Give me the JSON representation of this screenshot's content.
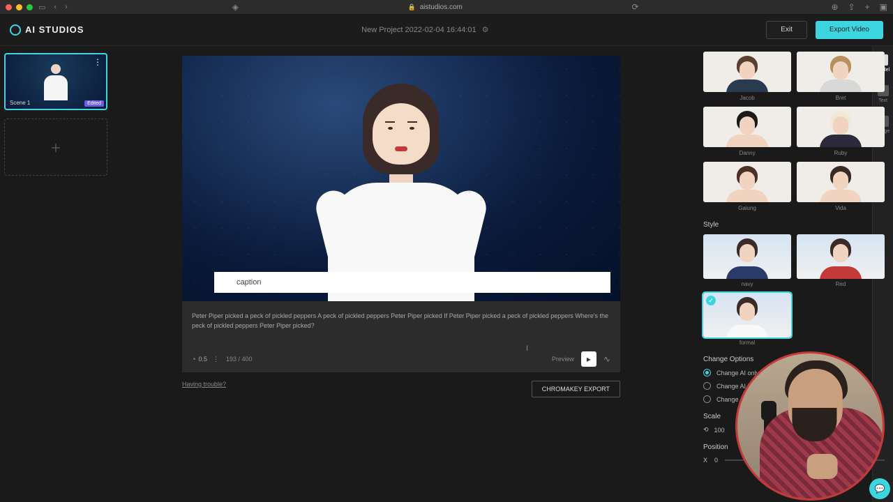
{
  "browser": {
    "url": "aistudios.com"
  },
  "logo": {
    "text": "AI STUDIOS"
  },
  "header": {
    "project_title": "New Project 2022-02-04 16:44:01",
    "exit": "Exit",
    "export": "Export Video"
  },
  "scenes": {
    "items": [
      {
        "label": "Scene 1",
        "badge": "Edited"
      }
    ]
  },
  "canvas": {
    "caption_placeholder": "caption"
  },
  "script": {
    "text": "Peter Piper picked a peck of pickled peppers A peck of pickled peppers Peter Piper picked If Peter Piper picked a peck of pickled peppers Where's the peck of pickled peppers Peter Piper picked?",
    "speed": "0.5",
    "char_count": "193 / 400",
    "preview_label": "Preview"
  },
  "links": {
    "trouble": "Having trouble?",
    "chromakey": "CHROMAKEY EXPORT"
  },
  "rail": {
    "model": "Model",
    "text": "Text",
    "image": "Image"
  },
  "models": [
    {
      "name": "Jacob",
      "hair": "#5a4030",
      "body": "#2a3a50"
    },
    {
      "name": "Bret",
      "hair": "#b89060",
      "body": "#d8d8d8"
    },
    {
      "name": "Danny",
      "hair": "#1a1a1a",
      "body": "#f0d4c0"
    },
    {
      "name": "Ruby",
      "hair": "#f0e8d8",
      "body": "#2a2a3a"
    },
    {
      "name": "Gaiung",
      "hair": "#4a3028",
      "body": "#f0d4c0"
    },
    {
      "name": "Vida",
      "hair": "#3a2a24",
      "body": "#f0d4c0"
    }
  ],
  "style": {
    "title": "Style",
    "items": [
      {
        "name": "navy",
        "body": "#2a3a6a",
        "selected": false
      },
      {
        "name": "Red",
        "body": "#c43a3a",
        "selected": false
      },
      {
        "name": "formal",
        "body": "#f8f8f8",
        "selected": true
      }
    ]
  },
  "change_options": {
    "title": "Change Options",
    "items": [
      {
        "label": "Change AI only in this scene",
        "selected": true
      },
      {
        "label": "Change AI in all scenes",
        "selected": false
      },
      {
        "label": "Change AI from this scene",
        "selected": false
      }
    ]
  },
  "scale": {
    "title": "Scale",
    "value": "100",
    "unit": "%"
  },
  "position": {
    "title": "Position",
    "x_label": "X",
    "x_value": "0"
  }
}
